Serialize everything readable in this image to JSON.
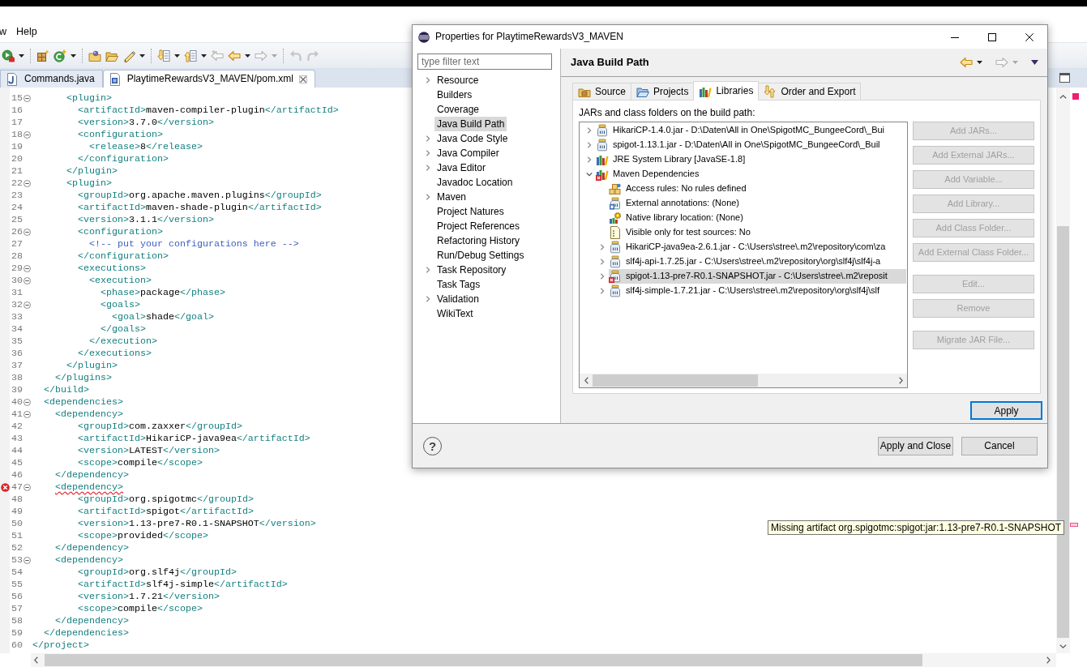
{
  "menu_bar": [
    "w",
    "Help"
  ],
  "toolbar": [
    [
      {
        "kind": "run",
        "dropdown": true,
        "disabled": false
      }
    ],
    [
      {
        "kind": "new-package",
        "dropdown": false,
        "disabled": false
      },
      {
        "kind": "new-class",
        "dropdown": true,
        "disabled": false
      }
    ],
    [
      {
        "kind": "open-type",
        "dropdown": false,
        "disabled": false
      },
      {
        "kind": "open-folder",
        "dropdown": false,
        "disabled": false
      },
      {
        "kind": "pen",
        "dropdown": true,
        "disabled": false
      }
    ],
    [
      {
        "kind": "next-annotation",
        "dropdown": true,
        "disabled": false
      },
      {
        "kind": "previous-annotation",
        "dropdown": true,
        "disabled": false
      },
      {
        "kind": "last-edit",
        "dropdown": false,
        "disabled": true
      },
      {
        "kind": "back",
        "dropdown": true,
        "disabled": false
      },
      {
        "kind": "forward",
        "dropdown": true,
        "disabled": true
      }
    ],
    [
      {
        "kind": "undo",
        "dropdown": false,
        "disabled": true
      },
      {
        "kind": "redo",
        "dropdown": false,
        "disabled": true
      }
    ]
  ],
  "editor_tabs": [
    {
      "label": "Commands.java",
      "kind": "java",
      "selected": false
    },
    {
      "label": "PlaytimeRewardsV3_MAVEN/pom.xml",
      "kind": "maven",
      "selected": true
    }
  ],
  "editor": {
    "lines": [
      {
        "number": "15",
        "code": "      <plugin>",
        "folding": true,
        "error": false
      },
      {
        "number": "16",
        "code": "        <artifactId>maven-compiler-plugin</artifactId>",
        "folding": false,
        "error": false
      },
      {
        "number": "17",
        "code": "        <version>3.7.0</version>",
        "folding": false,
        "error": false
      },
      {
        "number": "18",
        "code": "        <configuration>",
        "folding": true,
        "error": false
      },
      {
        "number": "19",
        "code": "          <release>8</release>",
        "folding": false,
        "error": false
      },
      {
        "number": "20",
        "code": "        </configuration>",
        "folding": false,
        "error": false
      },
      {
        "number": "21",
        "code": "      </plugin>",
        "folding": false,
        "error": false
      },
      {
        "number": "22",
        "code": "      <plugin>",
        "folding": true,
        "error": false
      },
      {
        "number": "23",
        "code": "        <groupId>org.apache.maven.plugins</groupId>",
        "folding": false,
        "error": false
      },
      {
        "number": "24",
        "code": "        <artifactId>maven-shade-plugin</artifactId>",
        "folding": false,
        "error": false
      },
      {
        "number": "25",
        "code": "        <version>3.1.1</version>",
        "folding": false,
        "error": false
      },
      {
        "number": "26",
        "code": "        <configuration>",
        "folding": true,
        "error": false
      },
      {
        "number": "27",
        "code": "          <!-- put your configurations here -->",
        "folding": false,
        "error": false
      },
      {
        "number": "28",
        "code": "        </configuration>",
        "folding": false,
        "error": false
      },
      {
        "number": "29",
        "code": "        <executions>",
        "folding": true,
        "error": false
      },
      {
        "number": "30",
        "code": "          <execution>",
        "folding": true,
        "error": false
      },
      {
        "number": "31",
        "code": "            <phase>package</phase>",
        "folding": false,
        "error": false
      },
      {
        "number": "32",
        "code": "            <goals>",
        "folding": true,
        "error": false
      },
      {
        "number": "33",
        "code": "              <goal>shade</goal>",
        "folding": false,
        "error": false
      },
      {
        "number": "34",
        "code": "            </goals>",
        "folding": false,
        "error": false
      },
      {
        "number": "35",
        "code": "          </execution>",
        "folding": false,
        "error": false
      },
      {
        "number": "36",
        "code": "        </executions>",
        "folding": false,
        "error": false
      },
      {
        "number": "37",
        "code": "      </plugin>",
        "folding": false,
        "error": false
      },
      {
        "number": "38",
        "code": "    </plugins>",
        "folding": false,
        "error": false
      },
      {
        "number": "39",
        "code": "  </build>",
        "folding": false,
        "error": false
      },
      {
        "number": "40",
        "code": "  <dependencies>",
        "folding": true,
        "error": false
      },
      {
        "number": "41",
        "code": "    <dependency>",
        "folding": true,
        "error": false
      },
      {
        "number": "42",
        "code": "        <groupId>com.zaxxer</groupId>",
        "folding": false,
        "error": false
      },
      {
        "number": "43",
        "code": "        <artifactId>HikariCP-java9ea</artifactId>",
        "folding": false,
        "error": false
      },
      {
        "number": "44",
        "code": "        <version>LATEST</version>",
        "folding": false,
        "error": false
      },
      {
        "number": "45",
        "code": "        <scope>compile</scope>",
        "folding": false,
        "error": false
      },
      {
        "number": "46",
        "code": "    </dependency>",
        "folding": false,
        "error": false
      },
      {
        "number": "47",
        "code": "    <dependency>",
        "folding": true,
        "error": true
      },
      {
        "number": "48",
        "code": "        <groupId>org.spigotmc</groupId>",
        "folding": false,
        "error": false
      },
      {
        "number": "49",
        "code": "        <artifactId>spigot</artifactId>",
        "folding": false,
        "error": false
      },
      {
        "number": "50",
        "code": "        <version>1.13-pre7-R0.1-SNAPSHOT</version>",
        "folding": false,
        "error": false
      },
      {
        "number": "51",
        "code": "        <scope>provided</scope>",
        "folding": false,
        "error": false
      },
      {
        "number": "52",
        "code": "    </dependency>",
        "folding": false,
        "error": false
      },
      {
        "number": "53",
        "code": "    <dependency>",
        "folding": true,
        "error": false
      },
      {
        "number": "54",
        "code": "        <groupId>org.slf4j</groupId>",
        "folding": false,
        "error": false
      },
      {
        "number": "55",
        "code": "        <artifactId>slf4j-simple</artifactId>",
        "folding": false,
        "error": false
      },
      {
        "number": "56",
        "code": "        <version>1.7.21</version>",
        "folding": false,
        "error": false
      },
      {
        "number": "57",
        "code": "        <scope>compile</scope>",
        "folding": false,
        "error": false
      },
      {
        "number": "58",
        "code": "    </dependency>",
        "folding": false,
        "error": false
      },
      {
        "number": "59",
        "code": "  </dependencies>",
        "folding": false,
        "error": false
      },
      {
        "number": "60",
        "code": "</project>",
        "folding": false,
        "error": false
      }
    ]
  },
  "tooltip": {
    "text": "Missing artifact org.spigotmc:spigot:jar:1.13-pre7-R0.1-SNAPSHOT"
  },
  "dialog": {
    "title": "Properties for PlaytimeRewardsV3_MAVEN",
    "filter": {
      "placeholder": "type filter text"
    },
    "pages": [
      {
        "label": "Resource",
        "expandable": true,
        "selected": false
      },
      {
        "label": "Builders",
        "expandable": false,
        "selected": false
      },
      {
        "label": "Coverage",
        "expandable": false,
        "selected": false
      },
      {
        "label": "Java Build Path",
        "expandable": false,
        "selected": true
      },
      {
        "label": "Java Code Style",
        "expandable": true,
        "selected": false
      },
      {
        "label": "Java Compiler",
        "expandable": true,
        "selected": false
      },
      {
        "label": "Java Editor",
        "expandable": true,
        "selected": false
      },
      {
        "label": "Javadoc Location",
        "expandable": false,
        "selected": false
      },
      {
        "label": "Maven",
        "expandable": true,
        "selected": false
      },
      {
        "label": "Project Natures",
        "expandable": false,
        "selected": false
      },
      {
        "label": "Project References",
        "expandable": false,
        "selected": false
      },
      {
        "label": "Refactoring History",
        "expandable": false,
        "selected": false
      },
      {
        "label": "Run/Debug Settings",
        "expandable": false,
        "selected": false
      },
      {
        "label": "Task Repository",
        "expandable": true,
        "selected": false
      },
      {
        "label": "Task Tags",
        "expandable": false,
        "selected": false
      },
      {
        "label": "Validation",
        "expandable": true,
        "selected": false
      },
      {
        "label": "WikiText",
        "expandable": false,
        "selected": false
      }
    ],
    "page_title": "Java Build Path",
    "navigation": [
      {
        "kind": "back",
        "disabled": false
      },
      {
        "kind": "forward",
        "disabled": true
      }
    ],
    "tabs": [
      {
        "label": "Source",
        "kind": "source",
        "selected": false
      },
      {
        "label": "Projects",
        "kind": "projects",
        "selected": false
      },
      {
        "label": "Libraries",
        "kind": "libraries",
        "selected": true
      },
      {
        "label": "Order and Export",
        "kind": "order",
        "selected": false
      }
    ],
    "list_label": "JARs and class folders on the build path:",
    "entries": [
      {
        "label": "HikariCP-1.4.0.jar - D:\\Daten\\All in One\\SpigotMC_BungeeCord\\_Bui",
        "kind": "jar",
        "expanded": false,
        "selected": false,
        "error": false
      },
      {
        "label": "spigot-1.13.1.jar - D:\\Daten\\All in One\\SpigotMC_BungeeCord\\_Buil",
        "kind": "jar",
        "expanded": false,
        "selected": false,
        "error": false
      },
      {
        "label": "JRE System Library [JavaSE-1.8]",
        "kind": "library",
        "expanded": false,
        "selected": false,
        "error": false
      },
      {
        "label": "Maven Dependencies",
        "kind": "library",
        "expanded": true,
        "selected": false,
        "error": true,
        "attributes": [
          {
            "label": "Access rules: No rules defined",
            "kind": "access"
          },
          {
            "label": "External annotations: (None)",
            "kind": "annotations"
          },
          {
            "label": "Native library location: (None)",
            "kind": "native"
          },
          {
            "label": "Visible only for test sources: No",
            "kind": "test"
          }
        ],
        "children": [
          {
            "label": "HikariCP-java9ea-2.6.1.jar - C:\\Users\\stree\\.m2\\repository\\com\\za",
            "kind": "jar",
            "expanded": false,
            "selected": false,
            "error": false
          },
          {
            "label": "slf4j-api-1.7.25.jar - C:\\Users\\stree\\.m2\\repository\\org\\slf4j\\slf4j-a",
            "kind": "jar",
            "expanded": false,
            "selected": false,
            "error": false
          },
          {
            "label": "spigot-1.13-pre7-R0.1-SNAPSHOT.jar - C:\\Users\\stree\\.m2\\reposit",
            "kind": "jar",
            "expanded": false,
            "selected": true,
            "error": true
          },
          {
            "label": "slf4j-simple-1.7.21.jar - C:\\Users\\stree\\.m2\\repository\\org\\slf4j\\slf",
            "kind": "jar",
            "expanded": false,
            "selected": false,
            "error": false
          }
        ]
      }
    ],
    "button_groups": [
      [
        {
          "label": "Add JARs...",
          "disabled": true
        },
        {
          "label": "Add External JARs...",
          "disabled": true
        },
        {
          "label": "Add Variable...",
          "disabled": true
        },
        {
          "label": "Add Library...",
          "disabled": true
        },
        {
          "label": "Add Class Folder...",
          "disabled": true
        },
        {
          "label": "Add External Class Folder...",
          "disabled": true
        }
      ],
      [
        {
          "label": "Edit...",
          "disabled": true
        },
        {
          "label": "Remove",
          "disabled": true
        }
      ],
      [
        {
          "label": "Migrate JAR File...",
          "disabled": true
        }
      ]
    ],
    "apply_button": {
      "label": "Apply",
      "focused": true
    },
    "help_button": {
      "symbol": "?"
    },
    "footer_buttons": [
      {
        "label": "Apply and Close",
        "focused": false
      },
      {
        "label": "Cancel",
        "focused": false
      }
    ]
  }
}
